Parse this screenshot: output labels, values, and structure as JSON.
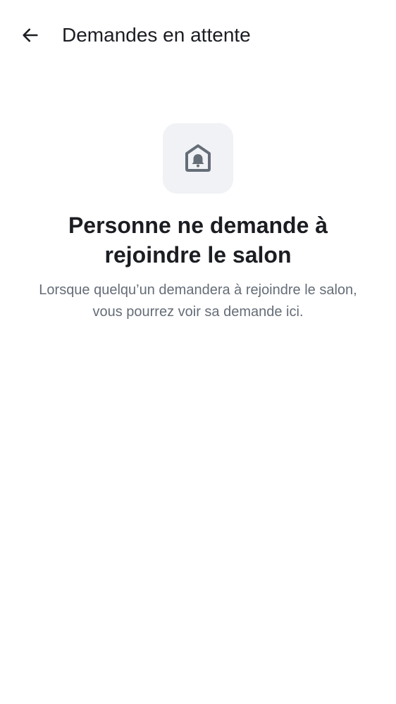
{
  "header": {
    "back_icon": "arrow-left-icon",
    "title": "Demandes en attente"
  },
  "empty_state": {
    "icon": "room-bell-icon",
    "heading": "Personne ne demande à rejoindre le salon",
    "body": "Lorsque quelqu’un demandera à rejoindre le salon, vous pourrez voir sa demande ici."
  },
  "colors": {
    "primary_text": "#1b1d22",
    "secondary_text": "#656d77",
    "icon_tile_bg": "#f0f2f5",
    "icon_color": "#656d77",
    "background": "#ffffff"
  }
}
